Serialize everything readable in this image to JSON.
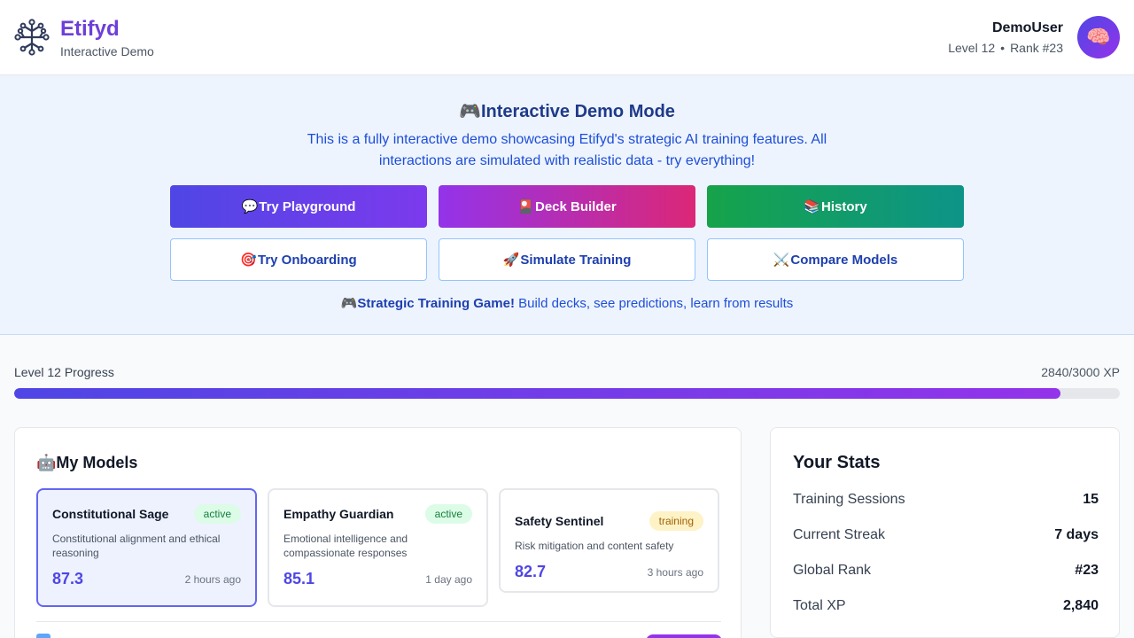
{
  "header": {
    "brand": "Etifyd",
    "subtitle": "Interactive Demo",
    "user_name": "DemoUser",
    "user_level": "Level 12",
    "user_rank": "Rank #23",
    "avatar_emoji": "🧠",
    "logo_icon": "neural-network-icon"
  },
  "demo": {
    "icon": "🎮",
    "title": "Interactive Demo Mode",
    "description": "This is a fully interactive demo showcasing Etifyd's strategic AI training features. All interactions are simulated with realistic data - try everything!",
    "buttons": [
      {
        "icon": "💬",
        "label": "Try Playground"
      },
      {
        "icon": "🎴",
        "label": "Deck Builder"
      },
      {
        "icon": "📚",
        "label": "History"
      },
      {
        "icon": "🎯",
        "label": "Try Onboarding"
      },
      {
        "icon": "🚀",
        "label": "Simulate Training"
      },
      {
        "icon": "⚔️",
        "label": "Compare Models"
      }
    ],
    "footer_icon": "🎮",
    "footer_bold": "Strategic Training Game!",
    "footer_text": " Build decks, see predictions, learn from results"
  },
  "progress": {
    "label": "Level 12 Progress",
    "value_text": "2840/3000 XP",
    "current": 2840,
    "max": 3000
  },
  "models": {
    "icon": "🤖",
    "title": "My Models",
    "items": [
      {
        "name": "Constitutional Sage",
        "status": "active",
        "description": "Constitutional alignment and ethical reasoning",
        "score": "87.3",
        "updated": "2 hours ago",
        "selected": true
      },
      {
        "name": "Empathy Guardian",
        "status": "active",
        "description": "Emotional intelligence and compassionate responses",
        "score": "85.1",
        "updated": "1 day ago",
        "selected": false
      },
      {
        "name": "Safety Sentinel",
        "status": "training",
        "description": "Risk mitigation and content safety",
        "score": "82.7",
        "updated": "3 hours ago",
        "selected": false
      }
    ]
  },
  "stats": {
    "title": "Your Stats",
    "rows": [
      {
        "label": "Training Sessions",
        "value": "15"
      },
      {
        "label": "Current Streak",
        "value": "7 days"
      },
      {
        "label": "Global Rank",
        "value": "#23"
      },
      {
        "label": "Total XP",
        "value": "2,840"
      }
    ]
  },
  "colors": {
    "brand": "#6d3fd8",
    "accent": "#4f46e5",
    "active": "#15803d",
    "training": "#a16207"
  }
}
